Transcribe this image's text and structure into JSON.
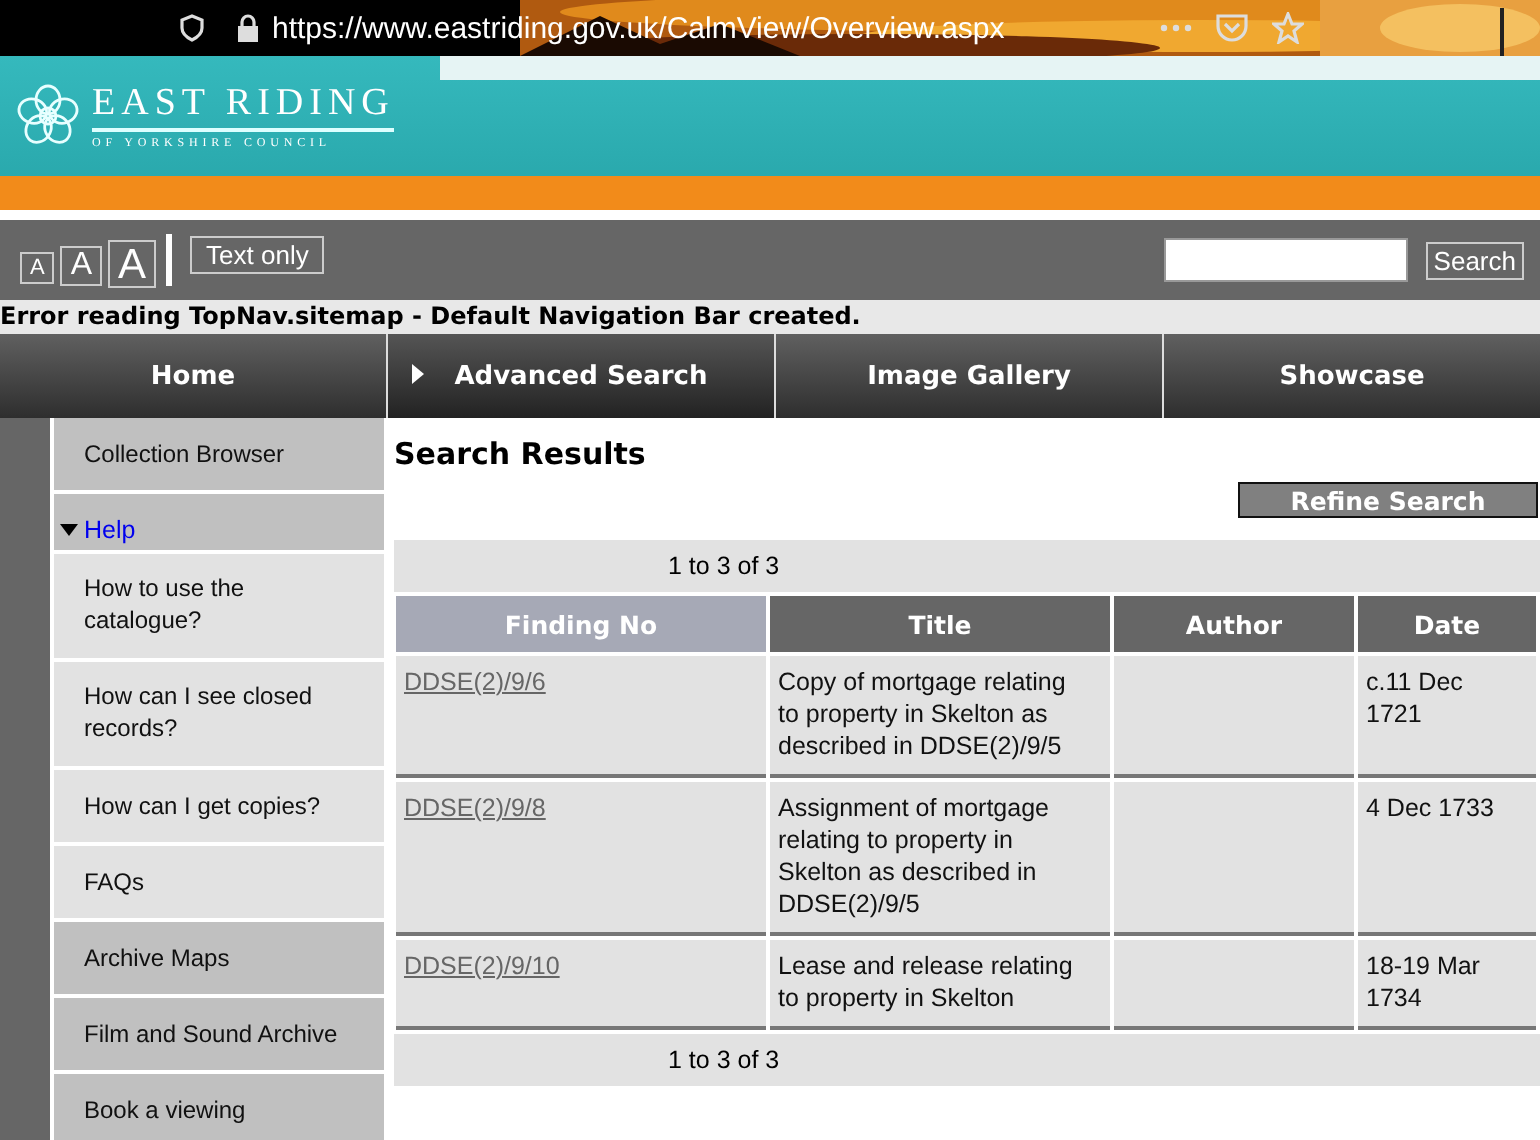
{
  "browser": {
    "url": "https://www.eastriding.gov.uk/CalmView/Overview.aspx"
  },
  "header": {
    "logo_title": "EAST RIDING",
    "logo_subtitle": "OF YORKSHIRE COUNCIL"
  },
  "toolbar": {
    "text_sizes": [
      {
        "label": "A",
        "selected": false
      },
      {
        "label": "A",
        "selected": false
      },
      {
        "label": "A",
        "selected": false
      }
    ],
    "text_only": "Text only",
    "search_button": "Search"
  },
  "error_message": "Error reading TopNav.sitemap - Default Navigation Bar created.",
  "nav": [
    {
      "label": "Home",
      "selected": false
    },
    {
      "label": "Advanced Search",
      "selected": true
    },
    {
      "label": "Image Gallery",
      "selected": false
    },
    {
      "label": "Showcase",
      "selected": false
    }
  ],
  "sidebar": {
    "items": [
      {
        "kind": "section",
        "label": "Collection Browser"
      },
      {
        "kind": "heading",
        "label": "Help",
        "expanded": true,
        "children": [
          {
            "label": "How to use the catalogue?"
          },
          {
            "label": "How can I see closed records?"
          },
          {
            "label": "How can I get copies?"
          },
          {
            "label": "FAQs"
          }
        ]
      },
      {
        "kind": "section",
        "label": "Archive Maps"
      },
      {
        "kind": "section",
        "label": "Film and Sound Archive"
      },
      {
        "kind": "section",
        "label": "Book a viewing"
      }
    ]
  },
  "results": {
    "title": "Search Results",
    "refine_button": "Refine Search",
    "pager_top": "1 to 3 of 3",
    "pager_bottom": "1 to 3 of 3",
    "columns": [
      {
        "label": "Finding No",
        "sorted": true
      },
      {
        "label": "Title",
        "sorted": false
      },
      {
        "label": "Author",
        "sorted": false
      },
      {
        "label": "Date",
        "sorted": false
      }
    ],
    "rows": [
      {
        "finding_no": "DDSE(2)/9/6",
        "title": "Copy of mortgage relating to property in Skelton as described in DDSE(2)/9/5",
        "date": "c.11 Dec 1721"
      },
      {
        "finding_no": "DDSE(2)/9/8",
        "title": "Assignment of mortgage relating to property in Skelton as described in DDSE(2)/9/5",
        "date": "4 Dec 1733"
      },
      {
        "finding_no": "DDSE(2)/9/10",
        "title": "Lease and release relating to property in Skelton",
        "date": "18-19 Mar 1734"
      }
    ]
  }
}
